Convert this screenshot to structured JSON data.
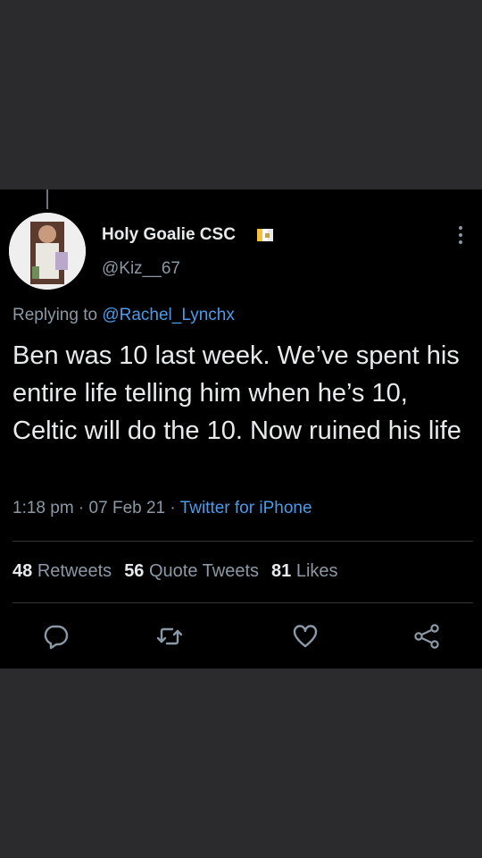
{
  "tweet": {
    "display_name": "Holy Goalie CSC",
    "flag_icon": "flag-icon",
    "handle": "@Kiz__67",
    "replying_prefix": "Replying to ",
    "replying_to": "@Rachel_Lynchx",
    "text": "Ben was 10 last week. We’ve spent his entire life telling him when he’s 10, Celtic will do the 10. Now ruined his life",
    "time": "1:18 pm",
    "sep1": " · ",
    "date": "07 Feb 21",
    "sep2": " · ",
    "source": "Twitter for iPhone",
    "stats": {
      "retweets_count": "48",
      "retweets_label": "Retweets",
      "quotes_count": "56",
      "quotes_label": "Quote Tweets",
      "likes_count": "81",
      "likes_label": "Likes"
    },
    "actions": [
      "reply-icon",
      "retweet-icon",
      "like-icon",
      "share-icon"
    ]
  },
  "colors": {
    "background": "#000000",
    "outer": "#2b2b2d",
    "text": "#e7e9ea",
    "secondary": "#8b98a5",
    "link": "#4c9ae8",
    "divider": "#2f3336"
  }
}
